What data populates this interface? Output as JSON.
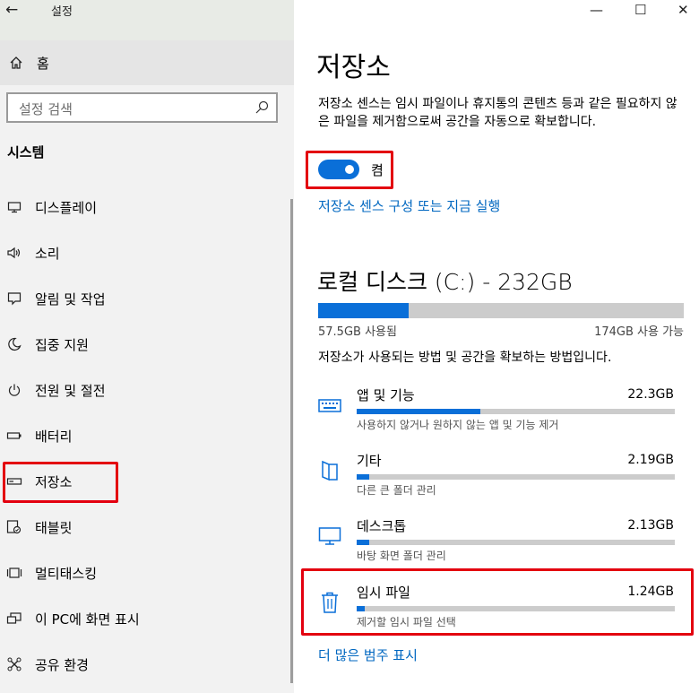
{
  "window": {
    "back": "←",
    "title": "설정",
    "minimize": "—",
    "maximize": "☐",
    "close": "✕"
  },
  "sidebar": {
    "home_label": "홈",
    "search_placeholder": "설정 검색",
    "section_heading": "시스템",
    "items": [
      {
        "label": "디스플레이",
        "icon": "display-icon"
      },
      {
        "label": "소리",
        "icon": "speaker-icon"
      },
      {
        "label": "알림 및 작업",
        "icon": "notification-icon"
      },
      {
        "label": "집중 지원",
        "icon": "moon-icon"
      },
      {
        "label": "전원 및 절전",
        "icon": "power-icon"
      },
      {
        "label": "배터리",
        "icon": "battery-icon"
      },
      {
        "label": "저장소",
        "icon": "storage-icon",
        "selected": true
      },
      {
        "label": "태블릿",
        "icon": "tablet-icon"
      },
      {
        "label": "멀티태스킹",
        "icon": "multitasking-icon"
      },
      {
        "label": "이 PC에 화면 표시",
        "icon": "project-icon"
      },
      {
        "label": "공유 환경",
        "icon": "share-icon"
      }
    ]
  },
  "main": {
    "title": "저장소",
    "description": "저장소 센스는 임시 파일이나 휴지통의 콘텐츠 등과 같은 필요하지 않은 파일을 제거함으로써 공간을 자동으로 확보합니다.",
    "toggle_label": "켬",
    "toggle_on": true,
    "configure_link": "저장소 센스 구성 또는 지금 실행",
    "disk": {
      "title": "로컬 디스크 (C:) - 232GB",
      "used_fraction": 0.248,
      "used_label": "57.5GB 사용됨",
      "free_label": "174GB 사용 가능",
      "description": "저장소가 사용되는 방법 및 공간을 확보하는 방법입니다."
    },
    "categories": [
      {
        "name": "앱 및 기능",
        "size": "22.3GB",
        "fraction": 0.39,
        "sub": "사용하지 않거나 원하지 않는 앱 및 기능 제거",
        "icon": "keyboard-icon"
      },
      {
        "name": "기타",
        "size": "2.19GB",
        "fraction": 0.04,
        "sub": "다른 큰 폴더 관리",
        "icon": "folder-icon"
      },
      {
        "name": "데스크톱",
        "size": "2.13GB",
        "fraction": 0.04,
        "sub": "바탕 화면 폴더 관리",
        "icon": "monitor-icon"
      },
      {
        "name": "임시 파일",
        "size": "1.24GB",
        "fraction": 0.025,
        "sub": "제거할 임시 파일 선택",
        "icon": "trash-icon"
      }
    ],
    "more_link": "더 많은 범주 표시"
  },
  "colors": {
    "accent": "#0a6fd8",
    "link": "#0067c0",
    "highlight": "#e3000f"
  }
}
